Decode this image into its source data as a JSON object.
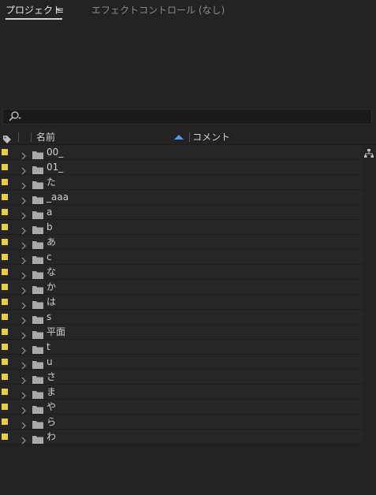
{
  "tabs": {
    "project_label": "プロジェクト",
    "menu_glyph": "≡",
    "effects_label": "エフェクトコントロール (なし)"
  },
  "search": {
    "value": "",
    "placeholder": ""
  },
  "columns": {
    "name": "名前",
    "comment": "コメント"
  },
  "colors": {
    "label_swatch": "#e2d244",
    "sort_arrow": "#4a9ff5",
    "background": "#232323"
  },
  "rows": [
    {
      "name": "00_"
    },
    {
      "name": "01_"
    },
    {
      "name": "た"
    },
    {
      "name": "_aaa"
    },
    {
      "name": "a"
    },
    {
      "name": "b"
    },
    {
      "name": "あ"
    },
    {
      "name": "c"
    },
    {
      "name": "な"
    },
    {
      "name": "か"
    },
    {
      "name": "は"
    },
    {
      "name": "s"
    },
    {
      "name": "平面"
    },
    {
      "name": "t"
    },
    {
      "name": "u"
    },
    {
      "name": "さ"
    },
    {
      "name": "ま"
    },
    {
      "name": "や"
    },
    {
      "name": "ら"
    },
    {
      "name": "わ"
    }
  ]
}
